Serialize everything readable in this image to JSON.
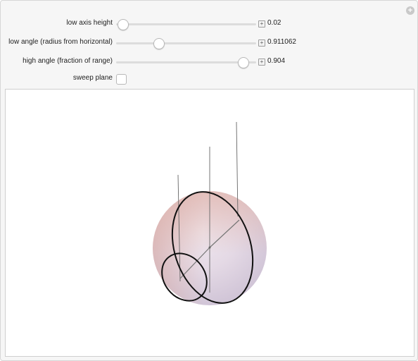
{
  "controls": {
    "low_axis_height": {
      "label": "low axis height",
      "value": "0.02",
      "fraction": 0.04
    },
    "low_angle": {
      "label": "low angle (radius from horizontal)",
      "value": "0.911062",
      "fraction": 0.3
    },
    "high_angle": {
      "label": "high angle (fraction of range)",
      "value": "0.904",
      "fraction": 0.904
    },
    "sweep_plane": {
      "label": "sweep plane",
      "checked": false
    }
  },
  "icons": {
    "corner": "plus-circle-icon",
    "stepper": "plus-square-icon"
  },
  "colors": {
    "sphere_top": "#e7c6c3",
    "sphere_mid": "#e6dde8",
    "sphere_bottom": "#cfc6d9",
    "curves": "#111111",
    "axes": "#555555"
  }
}
